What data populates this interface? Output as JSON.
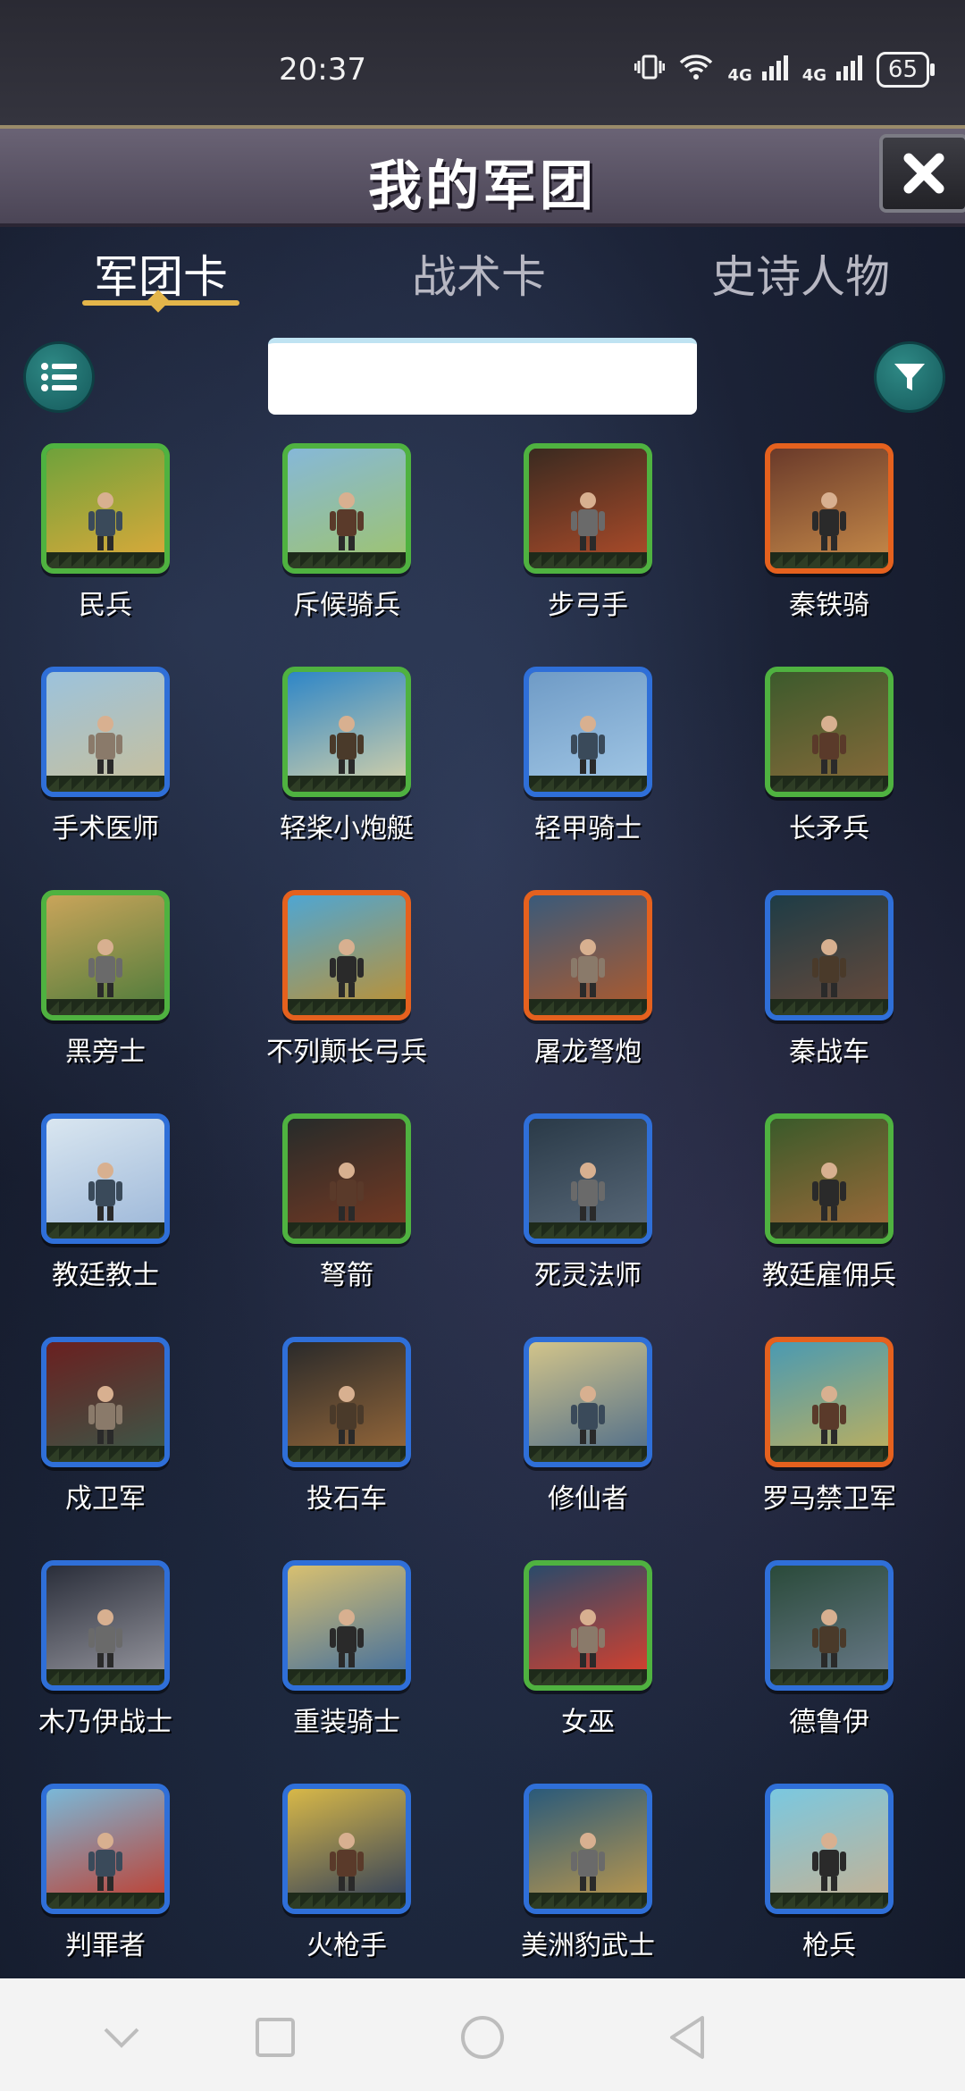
{
  "status_bar": {
    "time": "20:37",
    "battery": "65",
    "net1": "4G",
    "net2": "4G"
  },
  "header": {
    "title": "我的军团"
  },
  "tabs": [
    {
      "label": "军团卡",
      "active": true
    },
    {
      "label": "战术卡",
      "active": false
    },
    {
      "label": "史诗人物",
      "active": false
    }
  ],
  "search": {
    "value": "",
    "placeholder": ""
  },
  "cards": [
    {
      "name": "民兵",
      "rarity": "green"
    },
    {
      "name": "斥候骑兵",
      "rarity": "green"
    },
    {
      "name": "步弓手",
      "rarity": "green"
    },
    {
      "name": "秦铁骑",
      "rarity": "orange"
    },
    {
      "name": "手术医师",
      "rarity": "blue"
    },
    {
      "name": "轻桨小炮艇",
      "rarity": "green"
    },
    {
      "name": "轻甲骑士",
      "rarity": "blue"
    },
    {
      "name": "长矛兵",
      "rarity": "green"
    },
    {
      "name": "黑旁士",
      "rarity": "green"
    },
    {
      "name": "不列颠长弓兵",
      "rarity": "orange"
    },
    {
      "name": "屠龙弩炮",
      "rarity": "orange"
    },
    {
      "name": "秦战车",
      "rarity": "blue"
    },
    {
      "name": "教廷教士",
      "rarity": "blue"
    },
    {
      "name": "弩箭",
      "rarity": "green"
    },
    {
      "name": "死灵法师",
      "rarity": "blue"
    },
    {
      "name": "教廷雇佣兵",
      "rarity": "green"
    },
    {
      "name": "戍卫军",
      "rarity": "blue"
    },
    {
      "name": "投石车",
      "rarity": "blue"
    },
    {
      "name": "修仙者",
      "rarity": "blue"
    },
    {
      "name": "罗马禁卫军",
      "rarity": "orange"
    },
    {
      "name": "木乃伊战士",
      "rarity": "blue"
    },
    {
      "name": "重装骑士",
      "rarity": "blue"
    },
    {
      "name": "女巫",
      "rarity": "green"
    },
    {
      "name": "德鲁伊",
      "rarity": "blue"
    },
    {
      "name": "判罪者",
      "rarity": "blue"
    },
    {
      "name": "火枪手",
      "rarity": "blue"
    },
    {
      "name": "美洲豹武士",
      "rarity": "blue"
    },
    {
      "name": "枪兵",
      "rarity": "blue"
    }
  ],
  "icons": {
    "list": "list-icon",
    "filter": "filter-icon",
    "close": "close-icon",
    "nav": [
      "chevron-down-icon",
      "square-icon",
      "circle-icon",
      "back-triangle-icon"
    ]
  },
  "colors": {
    "green": "#4fb240",
    "blue": "#2f6fd8",
    "orange": "#e5611e",
    "accent": "#e3b54a"
  }
}
